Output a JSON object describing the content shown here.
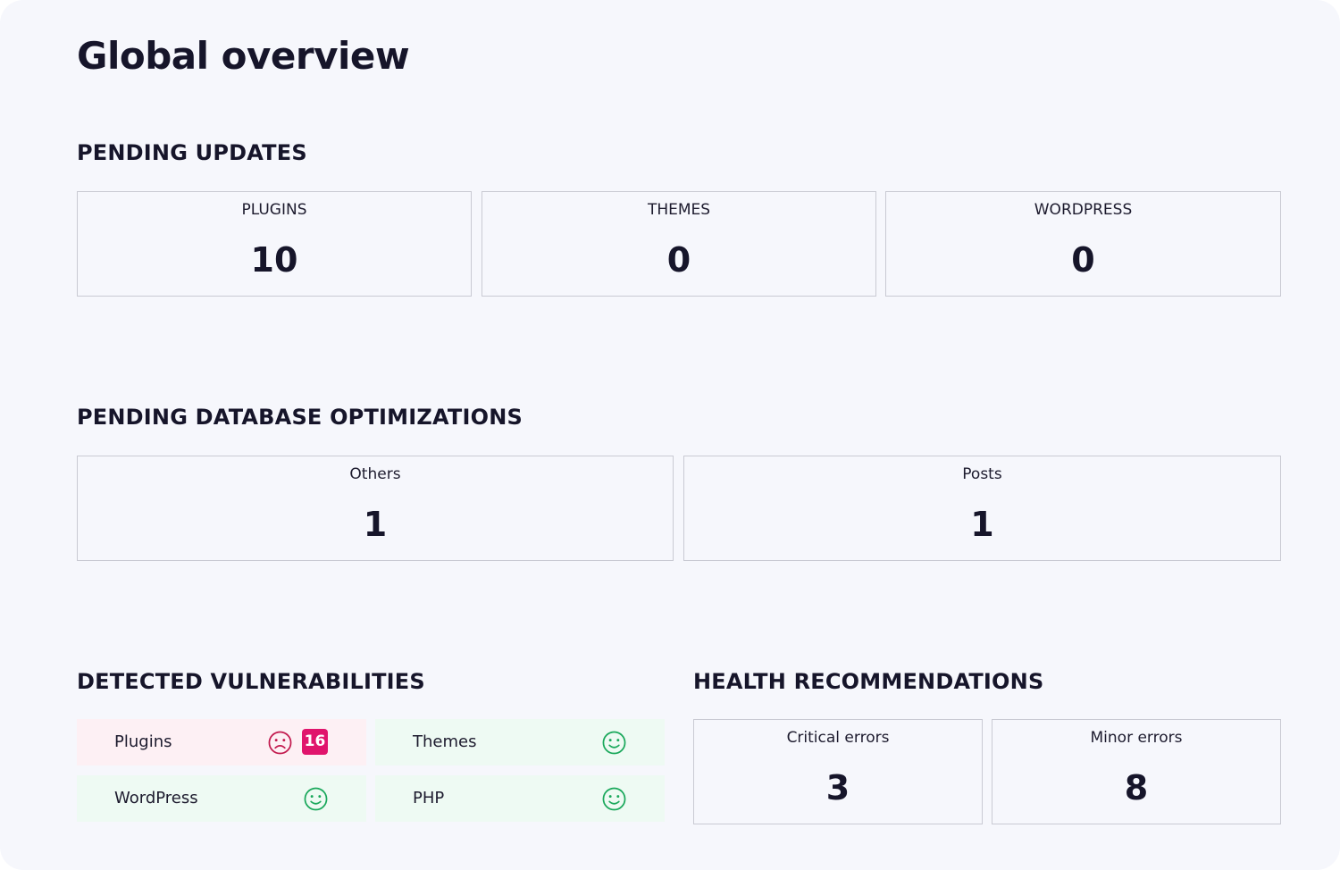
{
  "page": {
    "title": "Global overview"
  },
  "pending_updates": {
    "heading": "PENDING UPDATES",
    "items": [
      {
        "label": "PLUGINS",
        "value": "10"
      },
      {
        "label": "THEMES",
        "value": "0"
      },
      {
        "label": "WORDPRESS",
        "value": "0"
      }
    ]
  },
  "db_optimizations": {
    "heading": "PENDING DATABASE OPTIMIZATIONS",
    "items": [
      {
        "label": "Others",
        "value": "1"
      },
      {
        "label": "Posts",
        "value": "1"
      }
    ]
  },
  "vulnerabilities": {
    "heading": "DETECTED VULNERABILITIES",
    "items": [
      {
        "label": "Plugins",
        "status": "vulnerable",
        "icon": "sad-face-icon",
        "count": "16"
      },
      {
        "label": "Themes",
        "status": "ok",
        "icon": "smiley-face-icon"
      },
      {
        "label": "WordPress",
        "status": "ok",
        "icon": "smiley-face-icon"
      },
      {
        "label": "PHP",
        "status": "ok",
        "icon": "smiley-face-icon"
      }
    ]
  },
  "health": {
    "heading": "HEALTH RECOMMENDATIONS",
    "items": [
      {
        "label": "Critical errors",
        "value": "3"
      },
      {
        "label": "Minor errors",
        "value": "8"
      }
    ]
  },
  "colors": {
    "background": "#f6f7fc",
    "text": "#16152a",
    "border": "#c9cad3",
    "danger": "#e0146c",
    "danger_face": "#c21a4e",
    "danger_bg": "#fdf0f4",
    "ok": "#1aa85b",
    "ok_bg": "#eefaf3"
  }
}
